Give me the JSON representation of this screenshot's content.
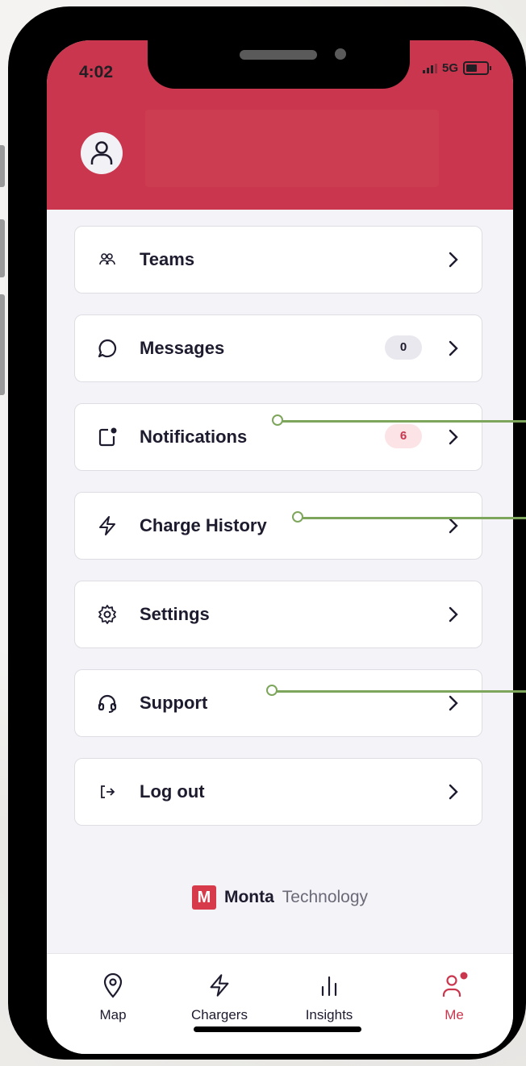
{
  "status": {
    "time": "4:02",
    "network": "5G"
  },
  "menu": [
    {
      "label": "Teams",
      "icon": "people-icon"
    },
    {
      "label": "Messages",
      "icon": "chat-bubble-icon",
      "badge": "0"
    },
    {
      "label": "Notifications",
      "icon": "notification-icon",
      "badge": "6"
    },
    {
      "label": "Charge History",
      "icon": "lightning-icon"
    },
    {
      "label": "Settings",
      "icon": "gear-icon"
    },
    {
      "label": "Support",
      "icon": "headset-icon"
    },
    {
      "label": "Log out",
      "icon": "logout-icon"
    }
  ],
  "brand": {
    "logo": "M",
    "name": "Monta",
    "suffix": "Technology"
  },
  "tabs": [
    {
      "label": "Map",
      "icon": "location-pin-icon"
    },
    {
      "label": "Chargers",
      "icon": "lightning-icon"
    },
    {
      "label": "Insights",
      "icon": "bar-chart-icon"
    },
    {
      "label": "Me",
      "icon": "person-icon",
      "active": true
    }
  ],
  "colors": {
    "accent": "#c9364d",
    "callout": "#7da65c",
    "background": "#f4f3f7"
  }
}
